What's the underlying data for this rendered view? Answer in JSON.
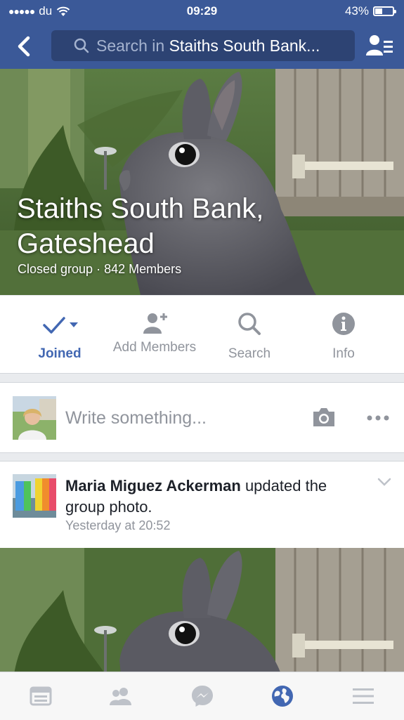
{
  "status_bar": {
    "carrier": "du",
    "time": "09:29",
    "battery_percent": "43%",
    "battery_level": 0.43
  },
  "nav": {
    "search_prefix": "Search in ",
    "search_group": "Staiths South Bank..."
  },
  "group": {
    "title": "Staiths South Bank, Gateshead",
    "subtitle": "Closed group · 842 Members"
  },
  "actions": [
    {
      "label": "Joined"
    },
    {
      "label": "Add Members"
    },
    {
      "label": "Search"
    },
    {
      "label": "Info"
    }
  ],
  "composer": {
    "placeholder": "Write something..."
  },
  "post": {
    "author": "Maria Miguez Ackerman",
    "action_text": " updated the group photo.",
    "timestamp": "Yesterday at 20:52"
  },
  "tabbar": {
    "items": [
      "news-feed-icon",
      "groups-icon",
      "messenger-icon",
      "globe-icon",
      "menu-icon"
    ]
  },
  "colors": {
    "brand": "#3b5998",
    "accent": "#4267b2",
    "muted": "#90949c"
  }
}
